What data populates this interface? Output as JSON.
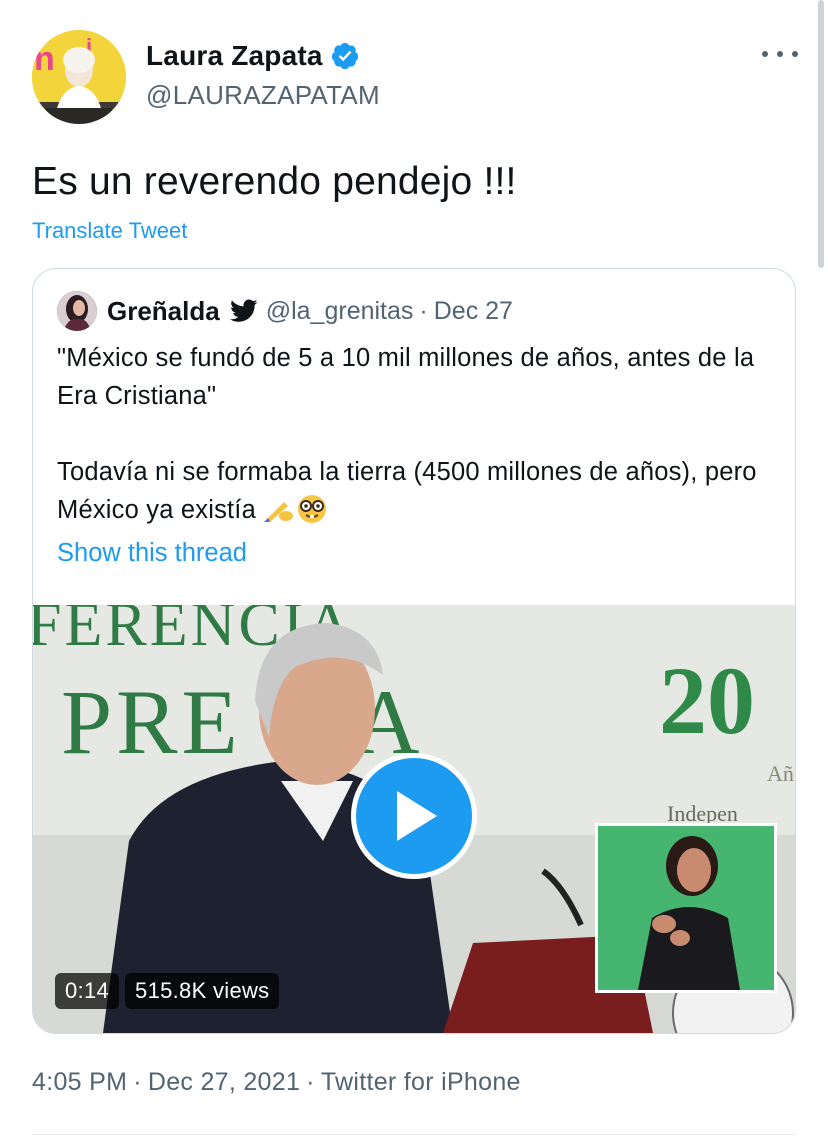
{
  "author": {
    "display_name": "Laura Zapata",
    "handle": "@LAURAZAPATAM",
    "verified": true,
    "avatar_icon": "profile-photo"
  },
  "tweet": {
    "text": "Es un reverendo pendejo !!!",
    "translate_label": "Translate Tweet"
  },
  "quoted": {
    "display_name": "Greñalda",
    "badge_icon": "twitter-bird-icon",
    "handle": "@la_grenitas",
    "separator": "·",
    "date": "Dec 27",
    "line1": "\"México se fundó de 5 a 10 mil millones de años, antes de la Era Cristiana\"",
    "line2": "Todavía ni se formaba la tierra (4500 millones de años), pero México ya existía",
    "emoji": "✍️🤓",
    "show_thread": "Show this thread",
    "video": {
      "duration": "0:14",
      "views": "515.8K views",
      "backdrop_text_top": "FERENCIA",
      "backdrop_text_mid": "PRE",
      "backdrop_text_mid2": "A",
      "backdrop_number": "20",
      "backdrop_small": "Indepen",
      "backdrop_small2": "Añ"
    }
  },
  "meta": {
    "time": "4:05 PM",
    "date": "Dec 27, 2021",
    "client": "Twitter for iPhone",
    "separator": "·"
  },
  "colors": {
    "accent": "#1d9bf0",
    "secondary_text": "#536471",
    "primary_text": "#0f1419",
    "border": "#cfd9de"
  }
}
